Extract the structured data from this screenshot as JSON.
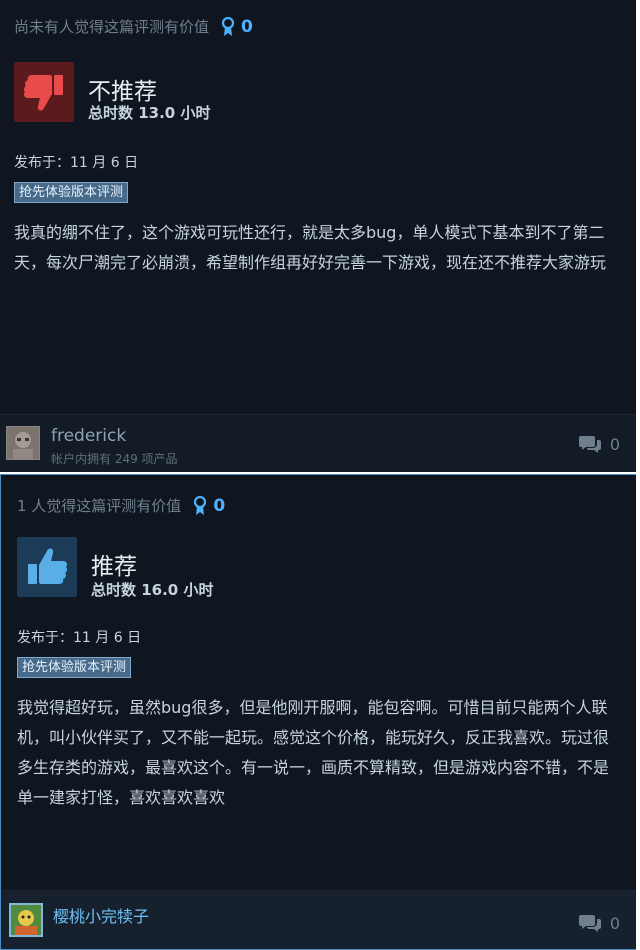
{
  "reviews": [
    {
      "helpful_text": "尚未有人觉得这篇评测有价值",
      "award_count": "0",
      "verdict": "不推荐",
      "hours": "总时数 13.0 小时",
      "posted": "发布于：11 月 6 日",
      "badge": "抢先体验版本评测",
      "body": "我真的绷不住了，这个游戏可玩性还行，就是太多bug，单人模式下基本到不了第二天，每次尸潮完了必崩溃，希望制作组再好好完善一下游戏，现在还不推荐大家游玩",
      "username": "frederick",
      "games_owned": "帐户内拥有 249 项产品",
      "comment_count": "0",
      "thumb_icon": "thumbs-down-icon",
      "thumb_color": "#e94b4b"
    },
    {
      "helpful_text": "1 人觉得这篇评测有价值",
      "award_count": "0",
      "verdict": "推荐",
      "hours": "总时数 16.0 小时",
      "posted": "发布于：11 月 6 日",
      "badge": "抢先体验版本评测",
      "body": "我觉得超好玩，虽然bug很多，但是他刚开服啊，能包容啊。可惜目前只能两个人联机，叫小伙伴买了，又不能一起玩。感觉这个价格，能玩好久，反正我喜欢。玩过很多生存类的游戏，最喜欢这个。有一说一，画质不算精致，但是游戏内容不错，不是单一建家打怪，喜欢喜欢喜欢",
      "username": "樱桃小完犊子",
      "comment_count": "0",
      "thumb_icon": "thumbs-up-icon",
      "thumb_color": "#5aaee8"
    }
  ],
  "colors": {
    "panel_bg": "#0f161f",
    "award_blue": "#4fb1ff",
    "accent_border": "#4c8dc4"
  }
}
